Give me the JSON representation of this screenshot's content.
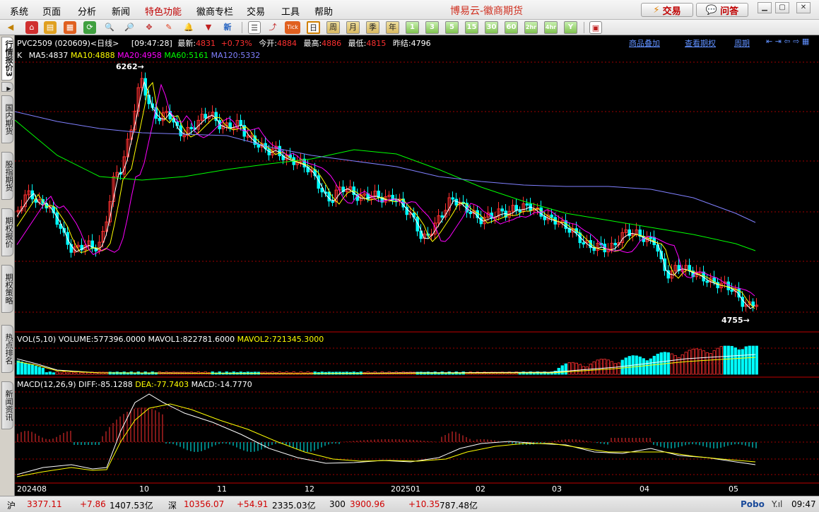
{
  "menubar": {
    "items": [
      {
        "label": "系统",
        "x": 14
      },
      {
        "label": "页面",
        "x": 60
      },
      {
        "label": "分析",
        "x": 110
      },
      {
        "label": "新闻",
        "x": 158
      },
      {
        "label": "特色功能",
        "x": 205,
        "highlight": true
      },
      {
        "label": "徽商专栏",
        "x": 278
      },
      {
        "label": "交易",
        "x": 349
      },
      {
        "label": "工具",
        "x": 398
      },
      {
        "label": "帮助",
        "x": 445
      }
    ],
    "app_title": "博易云-徽商期货",
    "trade_label": "交易",
    "ask_label": "问答"
  },
  "toolbar": {
    "periods": [
      "日",
      "周",
      "月",
      "季",
      "年",
      "1",
      "3",
      "5",
      "15",
      "30",
      "60",
      "2hr",
      "4hr",
      "Y"
    ],
    "active_period": "日",
    "tick_label": "Tick"
  },
  "left_tabs": [
    {
      "label": "行情报价3",
      "active": true
    },
    {
      "label": "国内期货"
    },
    {
      "label": "股指期货"
    },
    {
      "label": "期权报价"
    },
    {
      "label": "期权策略"
    },
    {
      "label": "热点排名"
    },
    {
      "label": "新闻资讯"
    }
  ],
  "quote_header": {
    "symbol": "PVC2509 (020609)",
    "period": "<日线>",
    "time": "[09:47:28]",
    "latest_label": "最新:",
    "latest": "4831",
    "change": "+0.73%",
    "open_label": "今开:",
    "open": "4884",
    "high_label": "最高:",
    "high": "4886",
    "low_label": "最低:",
    "low": "4815",
    "prev_label": "昨结:",
    "prev": "4796",
    "link_overlay": "商品叠加",
    "link_options": "查看期权",
    "link_cycle": "周期"
  },
  "ma_header": {
    "k": "K",
    "ma5": "MA5:4837",
    "ma10": "MA10:4888",
    "ma20": "MA20:4958",
    "ma60": "MA60:5161",
    "ma120": "MA120:5332"
  },
  "vol_header": {
    "label": "VOL(5,10)",
    "volume": "VOLUME:577396.0000",
    "mavol1": "MAVOL1:822781.6000",
    "mavol2": "MAVOL2:721345.3000"
  },
  "macd_header": {
    "label": "MACD(12,26,9)",
    "diff": "DIFF:-85.1288",
    "dea": "DEA:-77.7403",
    "macd": "MACD:-14.7770"
  },
  "annotations": {
    "high": "6262",
    "low": "4755"
  },
  "x_axis_labels": [
    "202408",
    "10",
    "11",
    "12",
    "202501",
    "02",
    "03",
    "04",
    "05"
  ],
  "colors": {
    "up": "#ff3030",
    "down": "#00ffff",
    "ma5": "#ffffff",
    "ma10": "#ffff00",
    "ma20": "#ff00ff",
    "ma60": "#00ff00",
    "ma120": "#8080ff",
    "grid": "#a00000",
    "bg": "#000000"
  },
  "chart_data": {
    "type": "candlestick",
    "x_ticks": [
      "202408",
      "10",
      "11",
      "12",
      "202501",
      "02",
      "03",
      "04",
      "05"
    ],
    "price_high": 6262,
    "price_low": 4755,
    "ma_values": {
      "ma5": 4837,
      "ma10": 4888,
      "ma20": 4958,
      "ma60": 5161,
      "ma120": 5332
    },
    "volume": 577396.0,
    "mavol1": 822781.6,
    "mavol2": 721345.3,
    "macd": {
      "diff": -85.1288,
      "dea": -77.7403,
      "macd": -14.777
    }
  },
  "statusbar": {
    "sh_label": "沪",
    "sh_value": "3377.11",
    "sh_change": "+7.86",
    "sh_amount": "1407.53亿",
    "sz_label": "深",
    "sz_value": "10356.07",
    "sz_change": "+54.91",
    "sz_amount": "2335.03亿",
    "hs_label": "300",
    "hs_value": "3900.96",
    "hs_change": "+10.35",
    "hs_amount": "787.48亿",
    "brand": "Pobo",
    "clock": "09:47"
  }
}
